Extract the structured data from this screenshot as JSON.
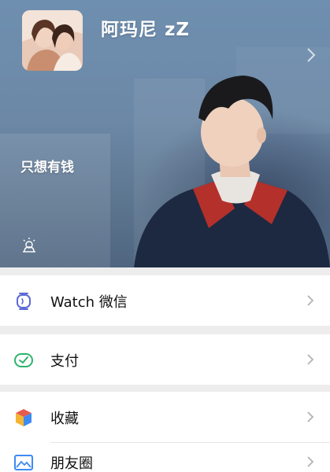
{
  "profile": {
    "nickname": "阿玛尼 zZ",
    "signature": "只想有钱"
  },
  "menu": {
    "watch": {
      "label": "Watch 微信",
      "icon": "watch-icon"
    },
    "pay": {
      "label": "支付",
      "icon": "pay-icon"
    },
    "favorites": {
      "label": "收藏",
      "icon": "favorites-icon"
    },
    "moments": {
      "label": "朋友圈",
      "icon": "moments-icon"
    }
  },
  "colors": {
    "watch_icon": "#5b6ad6",
    "pay_icon": "#2fb36b",
    "favorites_red": "#e75a4e",
    "favorites_yellow": "#f3b633",
    "favorites_blue": "#3d8bf2",
    "moments_icon": "#3d8bf2",
    "chevron": "#b2b2b2",
    "page_bg": "#ededed"
  }
}
